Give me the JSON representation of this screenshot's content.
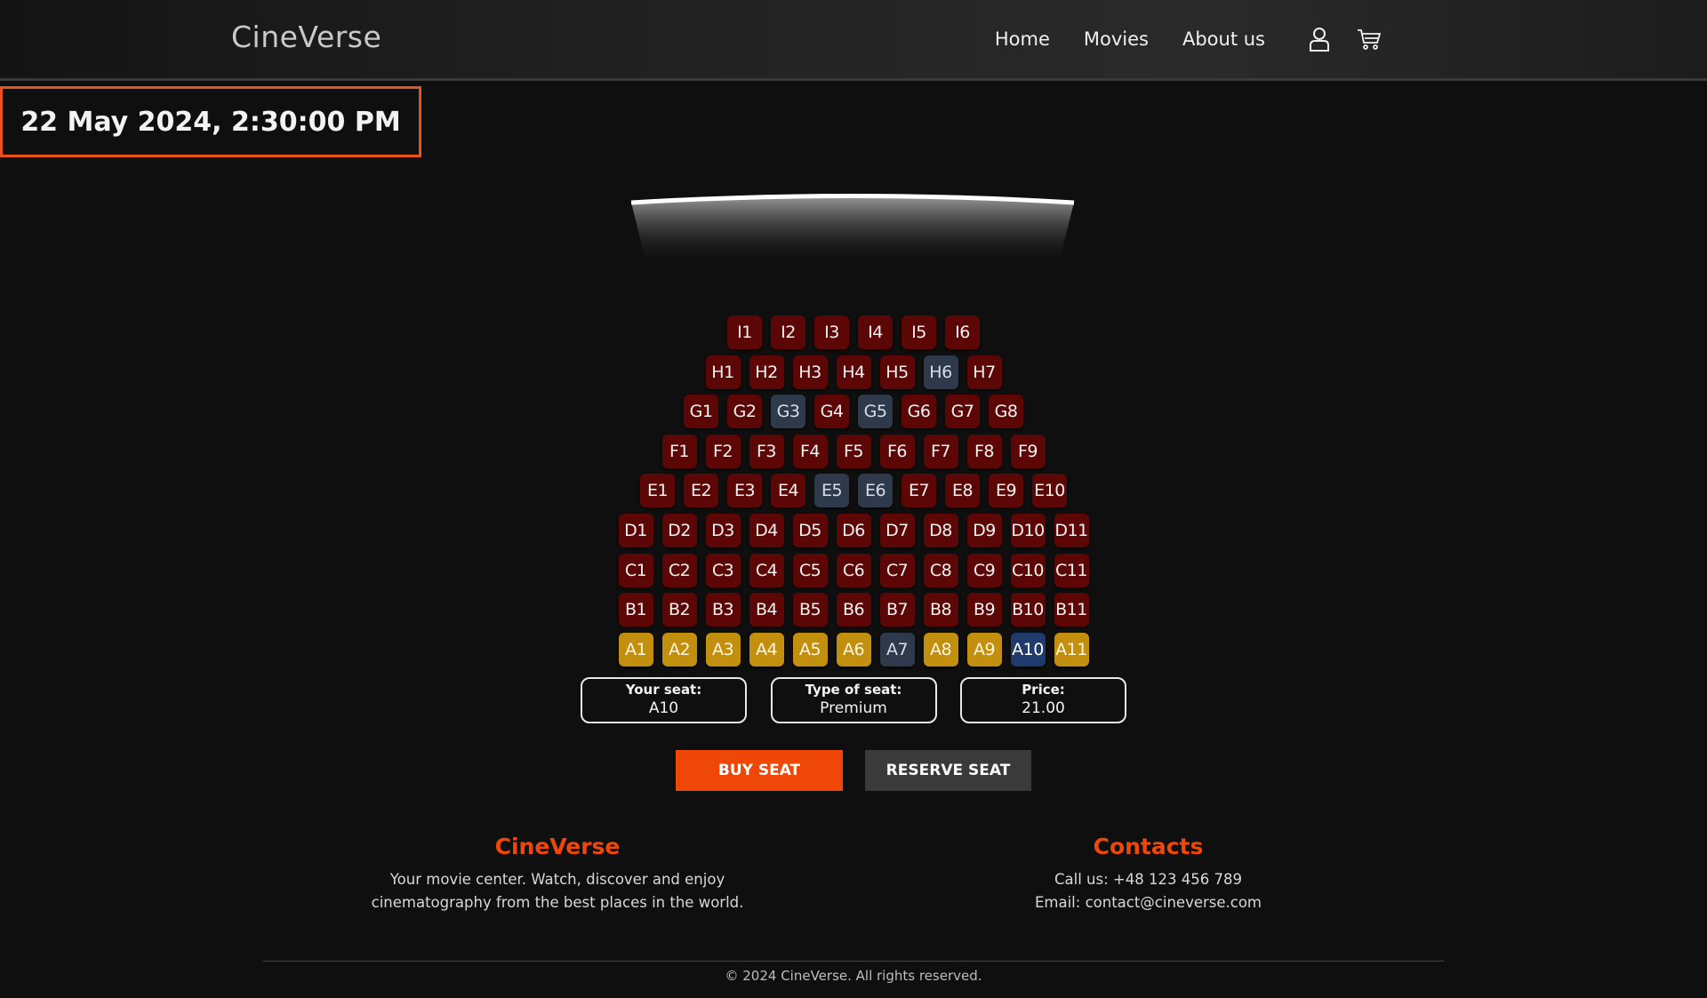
{
  "header": {
    "brand": "CineVerse",
    "nav": [
      "Home",
      "Movies",
      "About us"
    ],
    "icons": [
      "user-icon",
      "cart-icon"
    ]
  },
  "showtime": "22 May 2024, 2:30:00 PM",
  "seat_map": {
    "rows": [
      {
        "row": "I",
        "seats": [
          "I1",
          "I2",
          "I3",
          "I4",
          "I5",
          "I6"
        ]
      },
      {
        "row": "H",
        "seats": [
          "H1",
          "H2",
          "H3",
          "H4",
          "H5",
          "H6",
          "H7"
        ]
      },
      {
        "row": "G",
        "seats": [
          "G1",
          "G2",
          "G3",
          "G4",
          "G5",
          "G6",
          "G7",
          "G8"
        ]
      },
      {
        "row": "F",
        "seats": [
          "F1",
          "F2",
          "F3",
          "F4",
          "F5",
          "F6",
          "F7",
          "F8",
          "F9"
        ]
      },
      {
        "row": "E",
        "seats": [
          "E1",
          "E2",
          "E3",
          "E4",
          "E5",
          "E6",
          "E7",
          "E8",
          "E9",
          "E10"
        ]
      },
      {
        "row": "D",
        "seats": [
          "D1",
          "D2",
          "D3",
          "D4",
          "D5",
          "D6",
          "D7",
          "D8",
          "D9",
          "D10",
          "D11"
        ]
      },
      {
        "row": "C",
        "seats": [
          "C1",
          "C2",
          "C3",
          "C4",
          "C5",
          "C6",
          "C7",
          "C8",
          "C9",
          "C10",
          "C11"
        ]
      },
      {
        "row": "B",
        "seats": [
          "B1",
          "B2",
          "B3",
          "B4",
          "B5",
          "B6",
          "B7",
          "B8",
          "B9",
          "B10",
          "B11"
        ]
      },
      {
        "row": "A",
        "seats": [
          "A1",
          "A2",
          "A3",
          "A4",
          "A5",
          "A6",
          "A7",
          "A8",
          "A9",
          "A10",
          "A11"
        ]
      }
    ],
    "taken": [
      "H6",
      "G3",
      "G5",
      "E5",
      "E6",
      "A7"
    ],
    "premium_row": "A",
    "selected": "A10",
    "colors": {
      "standard": "#5c0706",
      "taken": "#2e3a4c",
      "premium": "#c2900e",
      "selected": "#1f3b6b",
      "accent": "#ee4708"
    }
  },
  "selection": {
    "seat_label": "Your seat:",
    "seat_value": "A10",
    "type_label": "Type of seat:",
    "type_value": "Premium",
    "price_label": "Price:",
    "price_value": "21.00"
  },
  "actions": {
    "buy": "BUY SEAT",
    "reserve": "RESERVE SEAT"
  },
  "footer": {
    "about_title": "CineVerse",
    "about_line1": "Your movie center. Watch, discover and enjoy",
    "about_line2": "cinematography from the best places in the world.",
    "contacts_title": "Contacts",
    "phone": "Call us: +48 123 456 789",
    "email": "Email: contact@cineverse.com",
    "copyright": "© 2024 CineVerse. All rights reserved."
  }
}
